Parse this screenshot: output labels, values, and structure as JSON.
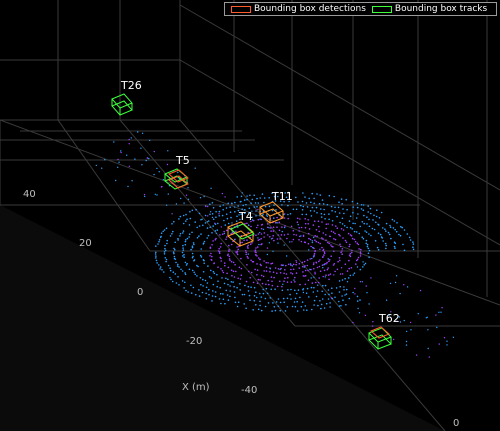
{
  "chart_data": {
    "type": "scatter",
    "title": "",
    "xlabel": "X (m)",
    "ylabel": "",
    "x_ticks": [
      "40",
      "20",
      "0",
      "-20",
      "-40"
    ],
    "y_ticks": [
      "0"
    ],
    "legend": {
      "placement": "top-right",
      "items": [
        {
          "label": "Bounding box detections",
          "color": "#ff5a2a"
        },
        {
          "label": "Bounding box tracks",
          "color": "#3cff3c"
        }
      ]
    },
    "tracks": [
      {
        "id": "T26",
        "detection": false
      },
      {
        "id": "T5",
        "detection": true
      },
      {
        "id": "T11",
        "detection": true
      },
      {
        "id": "T4",
        "detection": true
      },
      {
        "id": "T62",
        "detection": true
      }
    ],
    "colors": {
      "background": "#000000",
      "grid": "#3a3a3a",
      "points_near": "#a040ff",
      "points_far": "#2aa0ff",
      "axis_text": "#bfbfbf"
    }
  }
}
